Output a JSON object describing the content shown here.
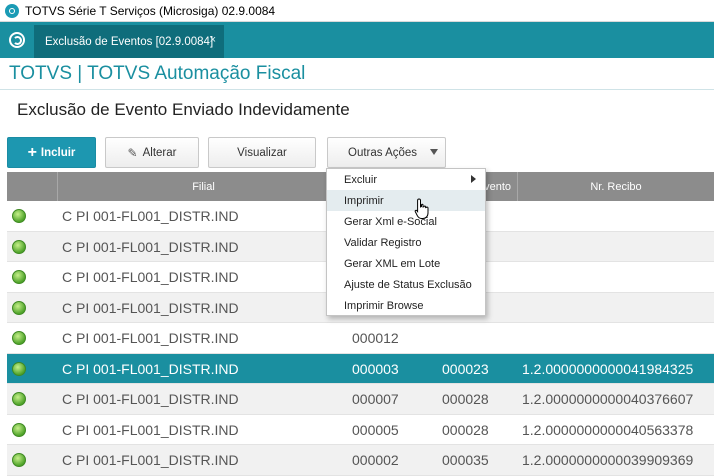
{
  "window": {
    "title": "TOTVS Série T Serviços (Microsiga) 02.9.0084"
  },
  "tabs": [
    {
      "label": "Exclusão de Eventos [02.9.0084]",
      "close": "×"
    }
  ],
  "product": {
    "name": "TOTVS | TOTVS Automação Fiscal"
  },
  "page": {
    "title": "Exclusão de Evento Enviado Indevidamente"
  },
  "toolbar": {
    "incluir": "Incluir",
    "alterar": "Alterar",
    "visualizar": "Visualizar",
    "outras": "Outras Ações"
  },
  "grid": {
    "headers": {
      "filial": "Filial",
      "evento_partial": "vento",
      "recibo": "Nr. Recibo"
    },
    "rows": [
      {
        "filial": "C PI 001-FL001_DISTR.IND",
        "col2": "",
        "col3": "",
        "recibo": ""
      },
      {
        "filial": "C PI 001-FL001_DISTR.IND",
        "col2": "",
        "col3": "",
        "recibo": ""
      },
      {
        "filial": "C PI 001-FL001_DISTR.IND",
        "col2": "",
        "col3": "",
        "recibo": ""
      },
      {
        "filial": "C PI 001-FL001_DISTR.IND",
        "col2": "",
        "col3": "",
        "recibo": ""
      },
      {
        "filial": "C PI 001-FL001_DISTR.IND",
        "col2": "000012",
        "col3": "",
        "recibo": ""
      },
      {
        "filial": "C PI 001-FL001_DISTR.IND",
        "col2": "000003",
        "col3": "000023",
        "recibo": "1.2.0000000000041984325"
      },
      {
        "filial": "C PI 001-FL001_DISTR.IND",
        "col2": "000007",
        "col3": "000028",
        "recibo": "1.2.0000000000040376607"
      },
      {
        "filial": "C PI 001-FL001_DISTR.IND",
        "col2": "000005",
        "col3": "000028",
        "recibo": "1.2.0000000000040563378"
      },
      {
        "filial": "C PI 001-FL001_DISTR.IND",
        "col2": "000002",
        "col3": "000035",
        "recibo": "1.2.0000000000039909369"
      }
    ],
    "selected_row": 5
  },
  "menu": {
    "items": [
      "Excluir",
      "Imprimir",
      "Gerar Xml e-Social",
      "Validar Registro",
      "Gerar XML em Lote",
      "Ajuste de Status Exclusão",
      "Imprimir Browse"
    ],
    "hovered": 1
  },
  "colors": {
    "accent": "#1a8fa0",
    "header_gray": "#8c8c8c",
    "status_green": "#4fa32a"
  }
}
